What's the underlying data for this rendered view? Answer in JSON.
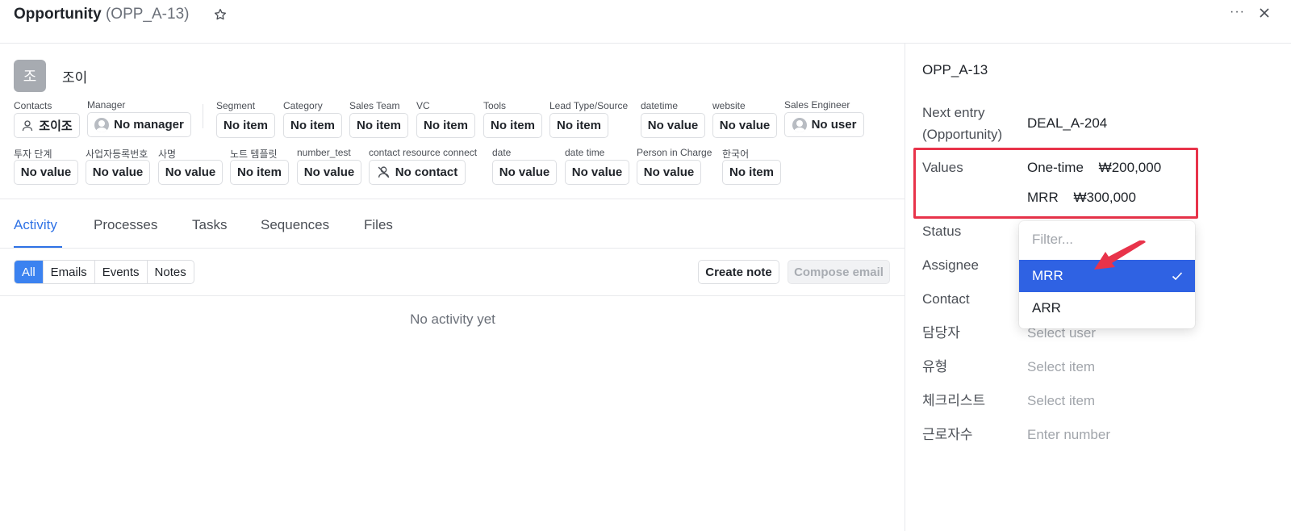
{
  "header": {
    "title": "Opportunity",
    "code": "(OPP_A-13)",
    "star_icon": "star-icon",
    "more_label": "···",
    "close_icon": "close-icon"
  },
  "owner": {
    "initial": "조",
    "name": "조이"
  },
  "fields_row1": [
    {
      "label": "Contacts",
      "value": "조이조",
      "icon": "person-icon"
    },
    {
      "label": "Manager",
      "value": "No manager",
      "icon": "avatar-icon"
    },
    {
      "label": "Segment",
      "value": "No item"
    },
    {
      "label": "Category",
      "value": "No item"
    },
    {
      "label": "Sales Team",
      "value": "No item"
    },
    {
      "label": "VC",
      "value": "No item"
    },
    {
      "label": "Tools",
      "value": "No item"
    },
    {
      "label": "Lead Type/Source",
      "value": "No item"
    },
    {
      "label": "datetime",
      "value": "No value"
    },
    {
      "label": "website",
      "value": "No value"
    },
    {
      "label": "Sales Engineer",
      "value": "No user",
      "icon": "avatar-icon"
    }
  ],
  "fields_row2": [
    {
      "label": "투자 단계",
      "value": "No value"
    },
    {
      "label": "사업자등록번호",
      "value": "No value"
    },
    {
      "label": "사명",
      "value": "No value"
    },
    {
      "label": "노트 템플릿",
      "value": "No item"
    },
    {
      "label": "number_test",
      "value": "No value"
    },
    {
      "label": "contact resource connect",
      "value": "No contact",
      "icon": "no-contact-icon"
    },
    {
      "label": "date",
      "value": "No value"
    },
    {
      "label": "date time",
      "value": "No value"
    },
    {
      "label": "Person in Charge",
      "value": "No value"
    },
    {
      "label": "한국어",
      "value": "No item"
    }
  ],
  "tabs": [
    "Activity",
    "Processes",
    "Tasks",
    "Sequences",
    "Files"
  ],
  "active_tab": "Activity",
  "activity_filters": [
    "All",
    "Emails",
    "Events",
    "Notes"
  ],
  "active_filter": "All",
  "buttons": {
    "create_note": "Create note",
    "compose_email": "Compose email"
  },
  "empty_text": "No activity yet",
  "right_panel": {
    "title": "OPP_A-13",
    "next_entry_label_line1": "Next entry",
    "next_entry_label_line2": "(Opportunity)",
    "next_entry_value": "DEAL_A-204",
    "values_label": "Values",
    "values": [
      {
        "type": "One-time",
        "amount": "₩200,000"
      },
      {
        "type": "MRR",
        "amount": "₩300,000"
      }
    ],
    "status_label": "Status",
    "assignee_label": "Assignee",
    "contact_label": "Contact",
    "manager_kr_label": "담당자",
    "manager_kr_placeholder": "Select user",
    "type_kr_label": "유형",
    "type_kr_placeholder": "Select item",
    "checklist_kr_label": "체크리스트",
    "checklist_kr_placeholder": "Select item",
    "employees_kr_label": "근로자수",
    "employees_kr_placeholder": "Enter number"
  },
  "dropdown": {
    "filter_placeholder": "Filter...",
    "options": [
      "MRR",
      "ARR"
    ],
    "selected": "MRR"
  },
  "colors": {
    "accent": "#2f72e5",
    "selected_option": "#2f62e3",
    "highlight_red": "#e8334a"
  }
}
